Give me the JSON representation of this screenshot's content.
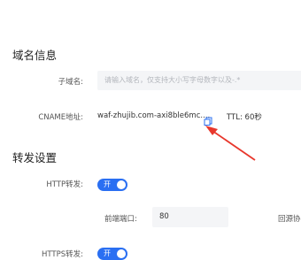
{
  "domain_info": {
    "title": "域名信息",
    "subdomain_label": "子域名:",
    "subdomain_placeholder": "请输入域名，仅支持大小写字母数字以及-.*",
    "cname_label": "CNAME地址:",
    "cname_value": "waf-zhujib.com-axi8ble6mc....",
    "ttl_text": "TTL: 60秒"
  },
  "forward_settings": {
    "title": "转发设置",
    "http_label": "HTTP转发:",
    "http_toggle_text": "开",
    "frontend_port_label": "前端端口:",
    "frontend_port_value": "80",
    "origin_label": "回源协",
    "https_label": "HTTPS转发:",
    "https_toggle_text": "开"
  },
  "colors": {
    "accent": "#2a6ff2",
    "annotation": "#e8372c"
  }
}
